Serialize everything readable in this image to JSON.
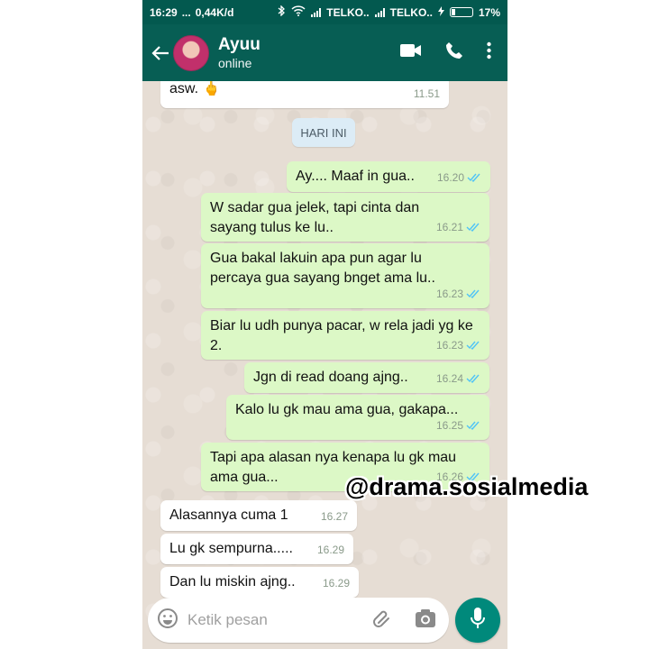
{
  "status_bar": {
    "time": "16:29",
    "dots": "...",
    "speed": "0,44K/d",
    "carrier1": "TELKO..",
    "carrier2": "TELKO..",
    "battery": "17%"
  },
  "header": {
    "contact_name": "Ayuu",
    "contact_status": "online",
    "icons": [
      "back-arrow-icon",
      "video-call-icon",
      "phone-icon",
      "more-vert-icon"
    ]
  },
  "date_chip": "HARI INI",
  "messages": [
    {
      "dir": "in",
      "text": "asw. 🖕",
      "time": "11.51"
    },
    {
      "dir": "out",
      "text": "Ay.... Maaf in gua..",
      "time": "16.20"
    },
    {
      "dir": "out",
      "text": "W sadar gua jelek, tapi cinta dan sayang tulus ke lu..",
      "time": "16.21"
    },
    {
      "dir": "out",
      "text": "Gua bakal lakuin apa pun agar lu percaya gua sayang bnget ama lu..",
      "time": "16.23"
    },
    {
      "dir": "out",
      "text": "Biar lu udh punya pacar, w rela jadi yg ke 2.",
      "time": "16.23"
    },
    {
      "dir": "out",
      "text": "Jgn di read doang ajng..",
      "time": "16.24"
    },
    {
      "dir": "out",
      "text": "Kalo lu gk mau ama gua, gakapa...",
      "time": "16.25"
    },
    {
      "dir": "out",
      "text": "Tapi apa alasan nya kenapa lu gk mau ama gua...",
      "time": "16.26"
    },
    {
      "dir": "in",
      "text": "Alasannya cuma 1",
      "time": "16.27"
    },
    {
      "dir": "in",
      "text": "Lu gk sempurna.....",
      "time": "16.29"
    },
    {
      "dir": "in",
      "text": "Dan lu miskin ajng..",
      "time": "16.29"
    }
  ],
  "composer": {
    "placeholder": "Ketik pesan",
    "icons": [
      "emoji-icon",
      "attachment-icon",
      "camera-icon",
      "mic-icon"
    ]
  },
  "watermark": "@drama.sosialmedia",
  "colors": {
    "header": "#075e54",
    "status_bar": "#03594f",
    "outgoing_bubble": "#dcf8c6",
    "incoming_bubble": "#ffffff",
    "read_tick": "#4fc3f7",
    "mic_button": "#00897b"
  }
}
